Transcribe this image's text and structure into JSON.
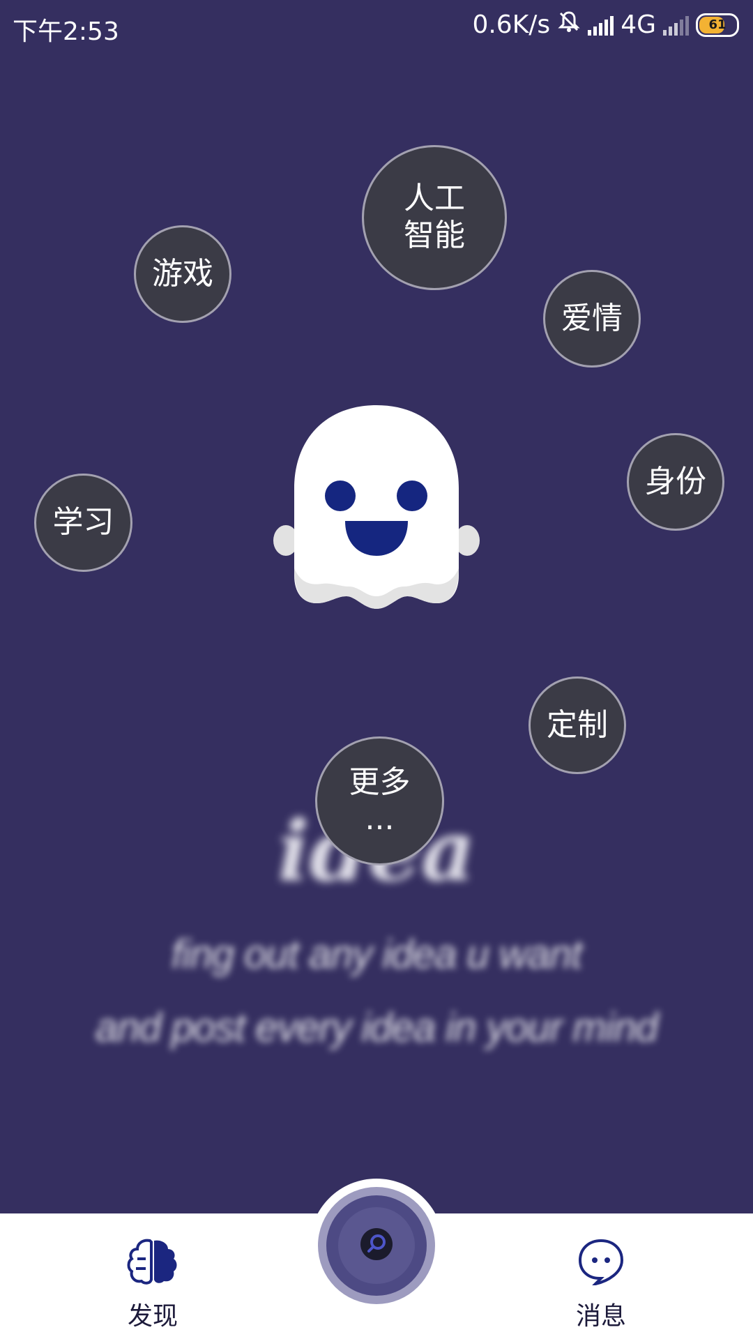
{
  "status_bar": {
    "time": "下午2:53",
    "net_speed": "0.6K/s",
    "network_type": "4G",
    "battery_level": "61"
  },
  "bubbles": [
    {
      "label": "人工\n智能"
    },
    {
      "label": "游戏"
    },
    {
      "label": "爱情"
    },
    {
      "label": "身份"
    },
    {
      "label": "学习"
    },
    {
      "label": "定制"
    },
    {
      "label": "更多\n..."
    }
  ],
  "hero": {
    "title": "idea",
    "line1": "fing out any idea u want",
    "line2": "and post every idea in your mind"
  },
  "bottom_nav": {
    "discover_label": "发现",
    "messages_label": "消息"
  },
  "colors": {
    "background": "#352f60",
    "bubble_fill": "#3b3b46",
    "accent": "#1b2680"
  }
}
